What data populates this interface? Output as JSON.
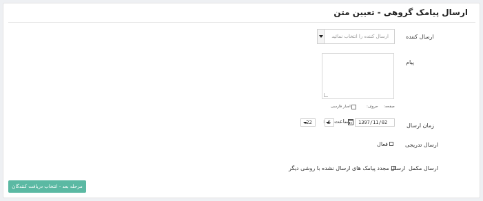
{
  "panel": {
    "title": "ارسال پیامک گروهی - تعیین متن"
  },
  "sender": {
    "label": "ارسال کننده",
    "placeholder": "ارسال کننده را انتخاب نمائید"
  },
  "message": {
    "label": "پیام",
    "pages_label": "صفحه:",
    "chars_label": "حروف:",
    "persian_label": "اجبار فارسی"
  },
  "send_time": {
    "label": "زمان ارسال",
    "date": "1397/11/02",
    "hour_label": "ساعت",
    "hour": "6",
    "separator": ":",
    "minute": "22"
  },
  "gradual": {
    "label": "ارسال تدریجی",
    "checkbox_label": "فعال"
  },
  "complete": {
    "label": "ارسال مکمل",
    "checkbox_label": "ارسال مجدد پیامک های ارسال نشده با روشی دیگر"
  },
  "actions": {
    "next_label": "مرحله بعد - انتخاب دریافت کنندگان"
  },
  "colors": {
    "accent": "#5bb9a3",
    "background": "#eef0f3"
  }
}
